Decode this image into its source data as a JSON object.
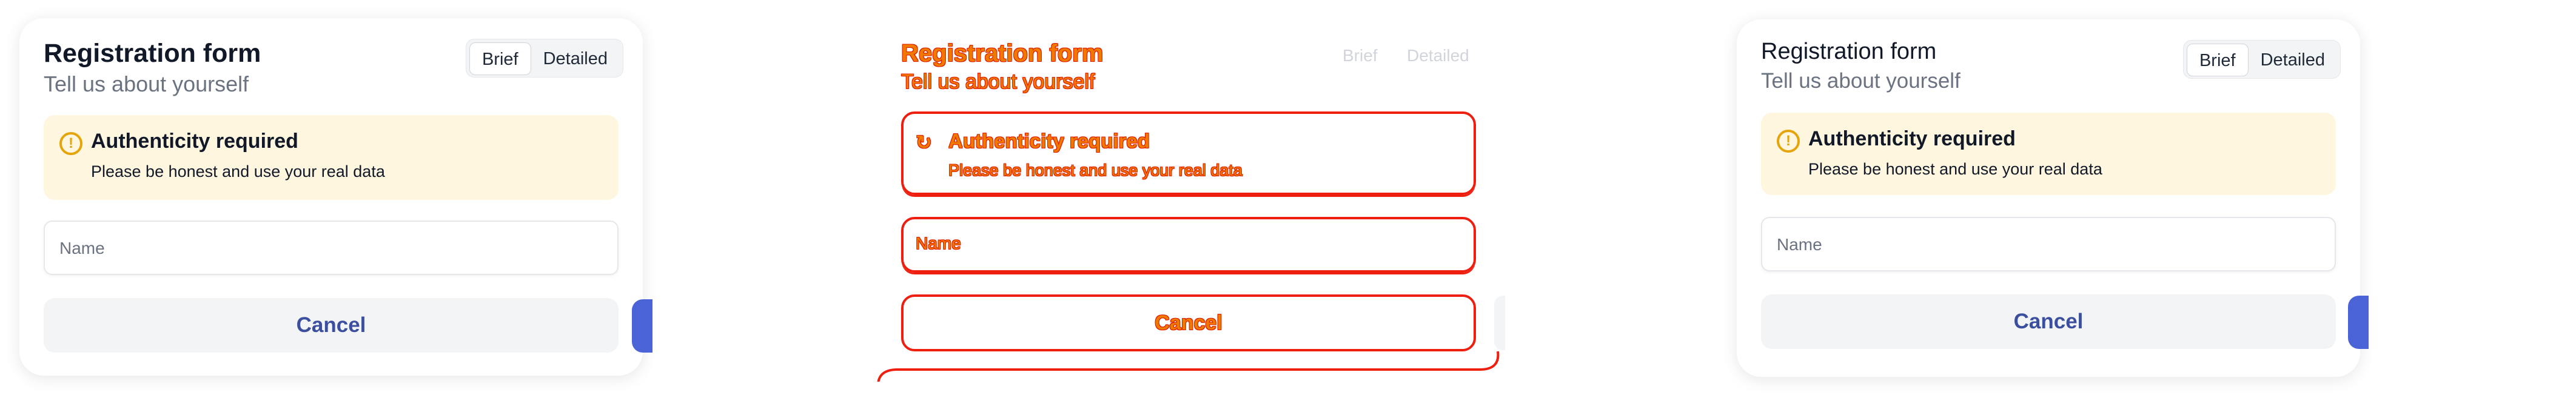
{
  "form": {
    "title": "Registration form",
    "subtitle": "Tell us about yourself",
    "toggle": {
      "brief": "Brief",
      "detailed": "Detailed",
      "selected": "Brief"
    },
    "alert": {
      "icon": "exclamation-circle-icon",
      "title": "Authenticity required",
      "text": "Please be honest and use your real data"
    },
    "name_label": "Name",
    "cancel_label": "Cancel"
  },
  "colors": {
    "alert_background": "#fef6de",
    "alert_icon": "#e5a50a",
    "cancel_text": "#3b4f9e",
    "primary_button": "#4a64d8",
    "glitch_outline": "#ee1f0f",
    "glitch_text": "#f07a00"
  }
}
